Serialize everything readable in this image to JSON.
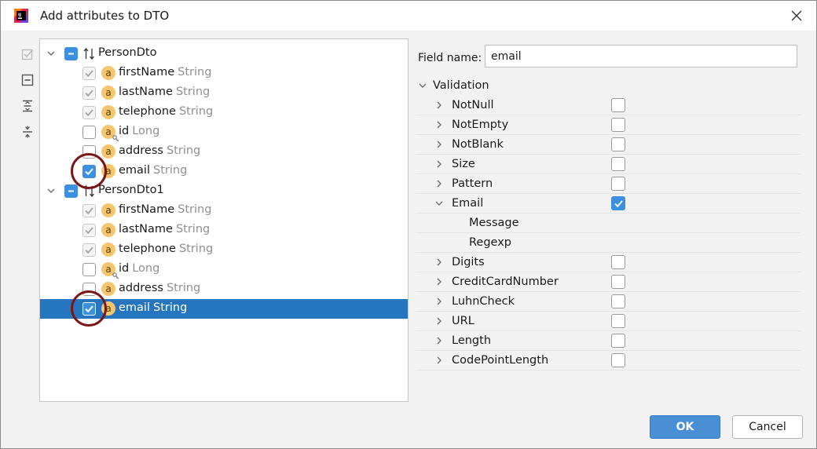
{
  "window": {
    "title": "Add attributes to DTO"
  },
  "toolbar": {
    "icons": [
      "select-all-icon",
      "collapse-all-icon",
      "expand-all-icon",
      "collapse-icon"
    ]
  },
  "tree": {
    "groups": [
      {
        "name": "PersonDto",
        "state": "partial",
        "items": [
          {
            "name": "firstName",
            "type": "String",
            "checked": true,
            "disabled": true,
            "key": false
          },
          {
            "name": "lastName",
            "type": "String",
            "checked": true,
            "disabled": true,
            "key": false
          },
          {
            "name": "telephone",
            "type": "String",
            "checked": true,
            "disabled": true,
            "key": false
          },
          {
            "name": "id",
            "type": "Long",
            "checked": false,
            "disabled": false,
            "key": true
          },
          {
            "name": "address",
            "type": "String",
            "checked": false,
            "disabled": false,
            "key": false
          },
          {
            "name": "email",
            "type": "String",
            "checked": true,
            "disabled": false,
            "key": false
          }
        ]
      },
      {
        "name": "PersonDto1",
        "state": "partial",
        "items": [
          {
            "name": "firstName",
            "type": "String",
            "checked": true,
            "disabled": true,
            "key": false
          },
          {
            "name": "lastName",
            "type": "String",
            "checked": true,
            "disabled": true,
            "key": false
          },
          {
            "name": "telephone",
            "type": "String",
            "checked": true,
            "disabled": true,
            "key": false
          },
          {
            "name": "id",
            "type": "Long",
            "checked": false,
            "disabled": false,
            "key": true
          },
          {
            "name": "address",
            "type": "String",
            "checked": false,
            "disabled": false,
            "key": false
          },
          {
            "name": "email",
            "type": "String",
            "checked": true,
            "disabled": false,
            "key": false,
            "selected": true
          }
        ]
      }
    ]
  },
  "details": {
    "field_label": "Field name:",
    "field_value": "email",
    "validation_header": "Validation",
    "constraints": [
      {
        "label": "NotNull",
        "checked": false,
        "expanded": false
      },
      {
        "label": "NotEmpty",
        "checked": false,
        "expanded": false
      },
      {
        "label": "NotBlank",
        "checked": false,
        "expanded": false
      },
      {
        "label": "Size",
        "checked": false,
        "expanded": false
      },
      {
        "label": "Pattern",
        "checked": false,
        "expanded": false
      },
      {
        "label": "Email",
        "checked": true,
        "expanded": true,
        "children": [
          "Message",
          "Regexp"
        ]
      },
      {
        "label": "Digits",
        "checked": false,
        "expanded": false
      },
      {
        "label": "CreditCardNumber",
        "checked": false,
        "expanded": false
      },
      {
        "label": "LuhnCheck",
        "checked": false,
        "expanded": false
      },
      {
        "label": "URL",
        "checked": false,
        "expanded": false
      },
      {
        "label": "Length",
        "checked": false,
        "expanded": false
      },
      {
        "label": "CodePointLength",
        "checked": false,
        "expanded": false
      }
    ]
  },
  "buttons": {
    "ok": "OK",
    "cancel": "Cancel"
  },
  "colors": {
    "accent": "#3d8fe0",
    "selection": "#2675bf",
    "highlight_circle": "#7a1616",
    "attribute_icon": "#f6c66f"
  }
}
